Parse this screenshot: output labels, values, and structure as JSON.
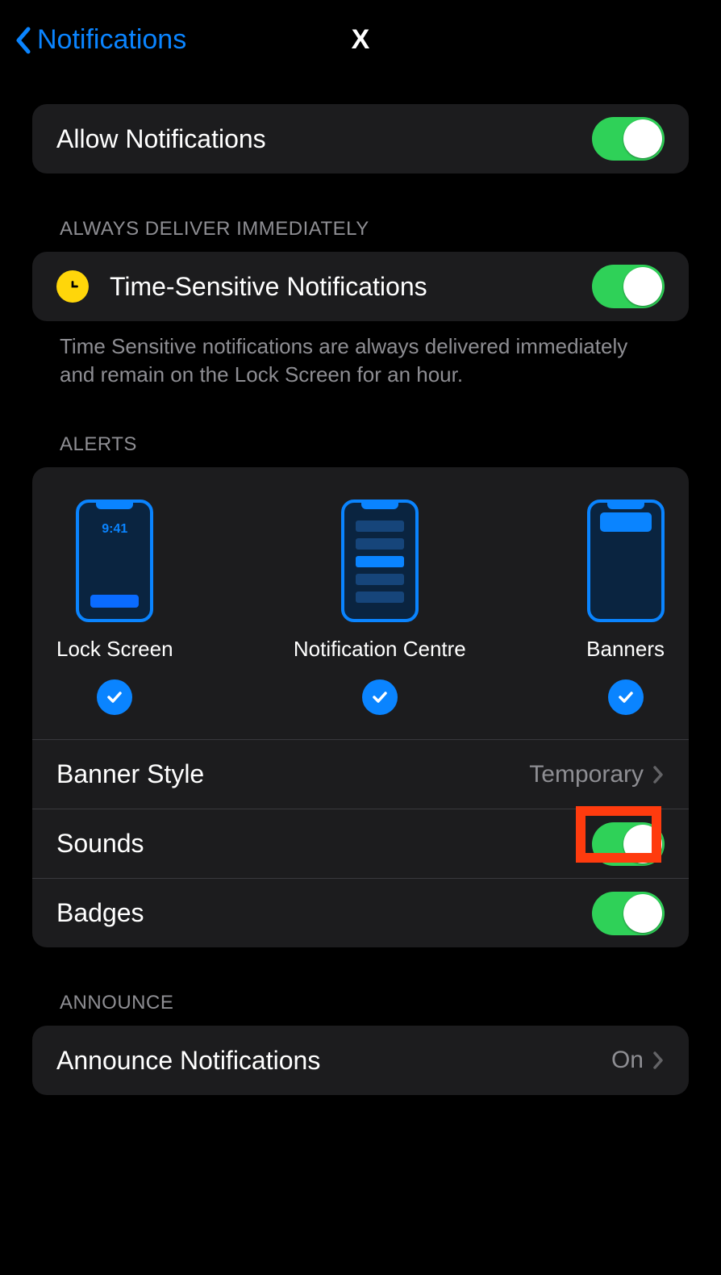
{
  "nav": {
    "back_label": "Notifications",
    "title": "X"
  },
  "allow": {
    "label": "Allow Notifications",
    "on": true
  },
  "time_sensitive": {
    "header": "Always Deliver Immediately",
    "label": "Time-Sensitive Notifications",
    "on": true,
    "footer": "Time Sensitive notifications are always delivered immediately and remain on the Lock Screen for an hour."
  },
  "alerts": {
    "header": "Alerts",
    "lock_time": "9:41",
    "options": {
      "lock_screen": {
        "label": "Lock Screen",
        "checked": true
      },
      "notification_centre": {
        "label": "Notification Centre",
        "checked": true
      },
      "banners": {
        "label": "Banners",
        "checked": true
      }
    },
    "banner_style": {
      "label": "Banner Style",
      "value": "Temporary"
    },
    "sounds": {
      "label": "Sounds",
      "on": true
    },
    "badges": {
      "label": "Badges",
      "on": true
    }
  },
  "announce": {
    "header": "Announce",
    "label": "Announce Notifications",
    "value": "On"
  },
  "colors": {
    "accent": "#0a84ff",
    "toggle_on": "#2fd158",
    "highlight": "#ff3b0e"
  }
}
